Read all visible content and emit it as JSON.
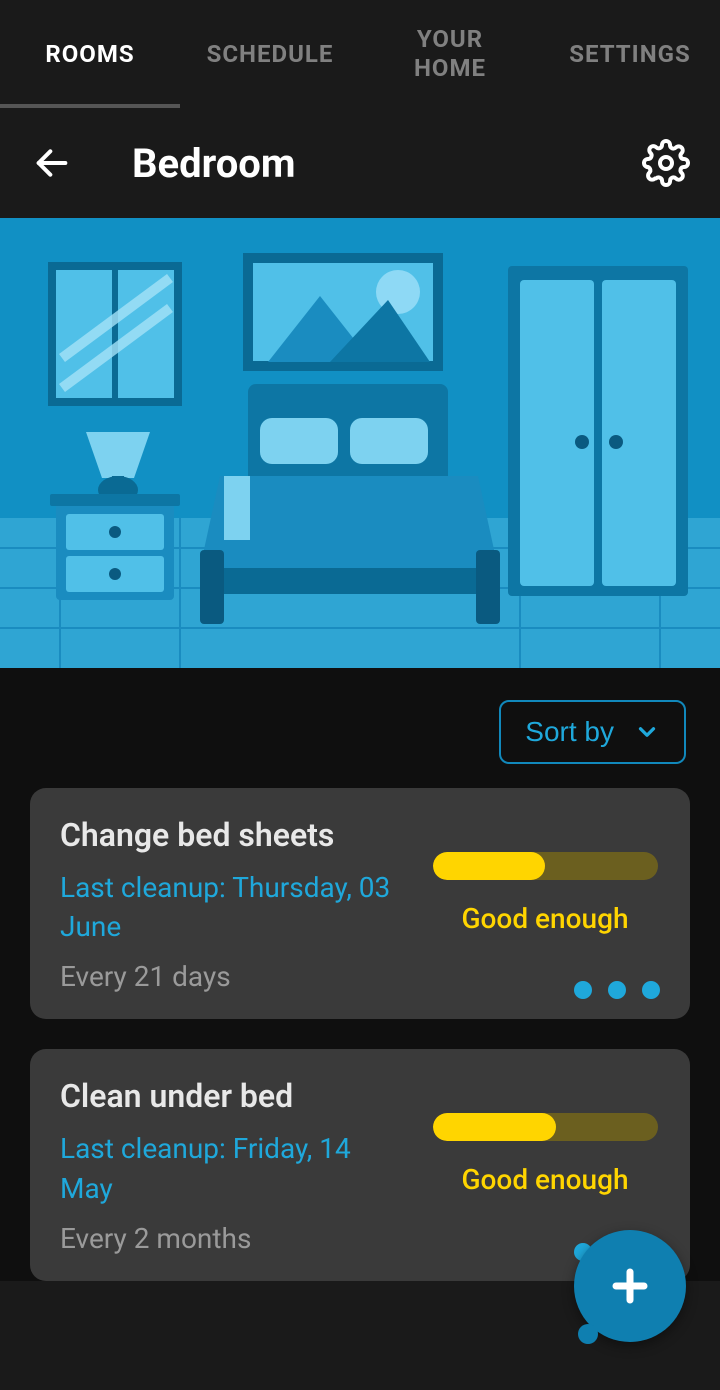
{
  "tabs": {
    "rooms": "ROOMS",
    "schedule": "SCHEDULE",
    "your_home": "YOUR\nHOME",
    "settings": "SETTINGS"
  },
  "header": {
    "title": "Bedroom"
  },
  "sort": {
    "label": "Sort by"
  },
  "tasks": [
    {
      "title": "Change bed sheets",
      "last_cleanup": "Last cleanup: Thursday, 03 June",
      "frequency": "Every 21 days",
      "status": "Good enough",
      "progress_pct": 50
    },
    {
      "title": "Clean under bed",
      "last_cleanup": "Last cleanup: Friday, 14 May",
      "frequency": "Every 2 months",
      "status": "Good enough",
      "progress_pct": 55
    }
  ]
}
